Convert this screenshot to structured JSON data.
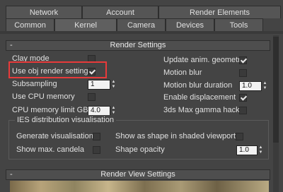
{
  "tabs_row1": [
    {
      "label": "Network",
      "key": "network"
    },
    {
      "label": "Account",
      "key": "account"
    },
    {
      "label": "Render Elements",
      "key": "render-elements"
    }
  ],
  "tabs_row2": [
    {
      "label": "Common",
      "key": "common"
    },
    {
      "label": "Kernel",
      "key": "kernel",
      "active": true
    },
    {
      "label": "Camera",
      "key": "camera"
    },
    {
      "label": "Devices",
      "key": "devices"
    },
    {
      "label": "Tools",
      "key": "tools"
    }
  ],
  "render_settings": {
    "title": "Render Settings",
    "collapse_symbol": "-",
    "left": {
      "clay_mode": {
        "label": "Clay mode",
        "checked": false
      },
      "use_obj_render_settings": {
        "label": "Use obj render settings",
        "checked": true
      },
      "subsampling": {
        "label": "Subsampling",
        "value": "1"
      },
      "use_cpu_memory": {
        "label": "Use CPU memory",
        "checked": false
      },
      "cpu_memory_limit": {
        "label": "CPU memory limit GB",
        "value": "4.0"
      }
    },
    "right": {
      "update_anim_geometry": {
        "label": "Update anim. geometry",
        "checked": true
      },
      "motion_blur": {
        "label": "Motion blur",
        "checked": false
      },
      "motion_blur_duration": {
        "label": "Motion blur duration",
        "value": "1.0"
      },
      "enable_displacement": {
        "label": "Enable displacement",
        "checked": true
      },
      "gamma_hack": {
        "label": "3ds Max gamma hack",
        "checked": false
      }
    },
    "ies": {
      "title": "IES distribution visualisation",
      "generate_visualisation": {
        "label": "Generate visualisation",
        "checked": false
      },
      "show_max_candela": {
        "label": "Show max. candela",
        "checked": false
      },
      "show_as_shape": {
        "label": "Show as shape in shaded viewports",
        "checked": false
      },
      "shape_opacity": {
        "label": "Shape opacity",
        "value": "1.0"
      }
    }
  },
  "render_view_settings": {
    "title": "Render View Settings",
    "collapse_symbol": "-"
  },
  "colors": {
    "highlight": "#e83a3a",
    "background": "#444444"
  }
}
